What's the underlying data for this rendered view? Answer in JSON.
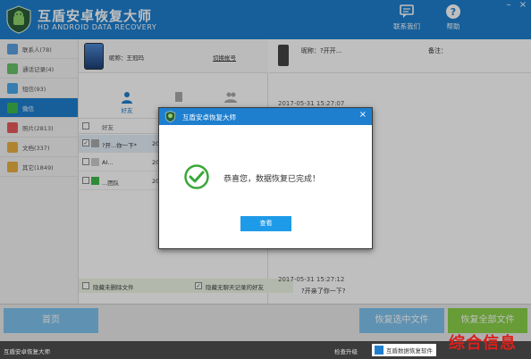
{
  "header": {
    "title": "互盾安卓恢复大师",
    "subtitle": "HD ANDROID DATA RECOVERY",
    "contact_label": "联系我们",
    "help_label": "帮助"
  },
  "sidebar": {
    "items": [
      {
        "label": "联系人(78)",
        "icon": "contacts-icon",
        "color": "#5aa0e0"
      },
      {
        "label": "通话记录(4)",
        "icon": "call-log-icon",
        "color": "#6ac26a"
      },
      {
        "label": "短信(93)",
        "icon": "sms-icon",
        "color": "#4aa8e8"
      },
      {
        "label": "微信",
        "icon": "wechat-icon",
        "color": "#3fba4a"
      },
      {
        "label": "照片(2813)",
        "icon": "photo-icon",
        "color": "#e85a5a"
      },
      {
        "label": "文档(337)",
        "icon": "document-icon",
        "color": "#e8b040"
      },
      {
        "label": "其它(1849)",
        "icon": "other-icon",
        "color": "#e8b040"
      }
    ]
  },
  "device": {
    "name": "昵称：王冠玛",
    "switch_label": "切换帐号"
  },
  "tabs": {
    "friends": "好友"
  },
  "list": {
    "header": "好友",
    "rows": [
      {
        "name": "?开...你一下*",
        "value": "20",
        "checked": true
      },
      {
        "name": "AI...",
        "value": "20",
        "checked": false
      },
      {
        "name": "...团队",
        "value": "20",
        "checked": false
      }
    ]
  },
  "options": {
    "show_deleted": "隐藏未删除文件",
    "hide_no_chat": "隐藏无聊天记录的好友"
  },
  "chat": {
    "nickname_label": "昵称：?开开...",
    "note_label": "备注：",
    "ts1": "2017-05-31 15:27:07",
    "ts2": "2017-05-31 15:27:12",
    "msg2": "?开亲了你一下?"
  },
  "buttons": {
    "home": "首页",
    "recover_selected": "恢复选中文件",
    "recover_all": "恢复全部文件"
  },
  "status": {
    "left": "互盾安卓恢复大师",
    "update": "检查升级",
    "brand": "互盾数据恢复软件"
  },
  "watermark": "综合信息",
  "dialog": {
    "title": "互盾安卓恢复大师",
    "message": "恭喜您，数据恢复已完成！",
    "button": "查看"
  },
  "colors": {
    "brand": "#1e7fcf",
    "success": "#3aa73a",
    "recover_all": "#8ad04a"
  }
}
